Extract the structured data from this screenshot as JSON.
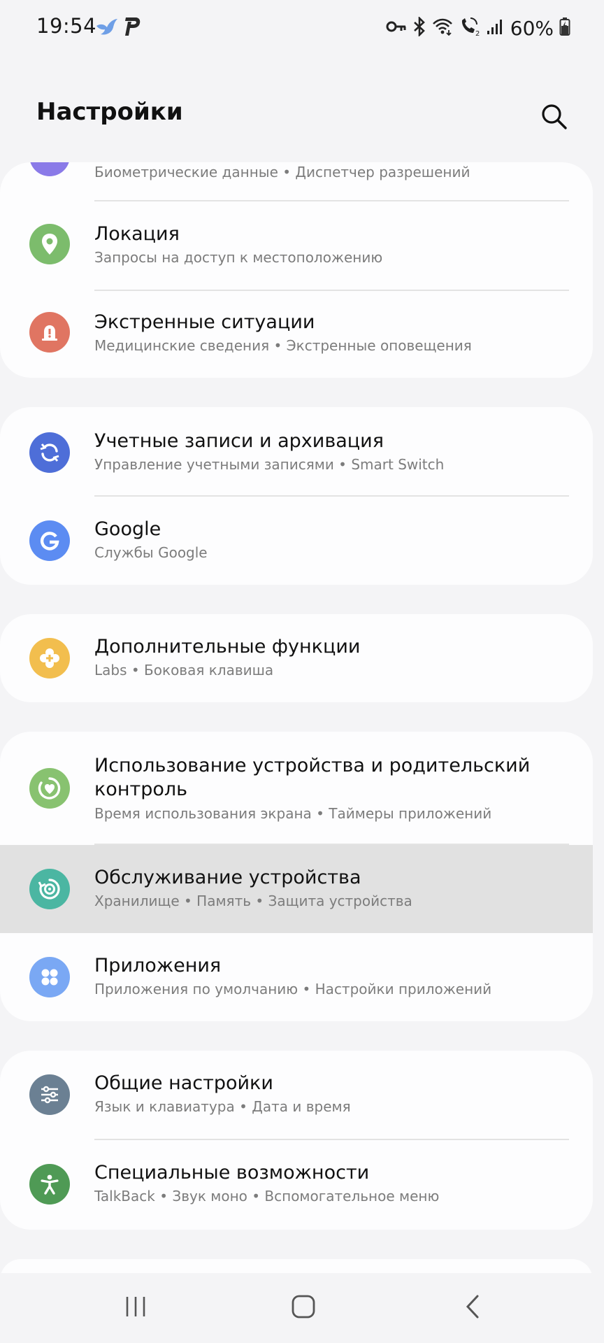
{
  "status": {
    "time": "19:54",
    "battery": "60%"
  },
  "header": {
    "title": "Настройки"
  },
  "icons": {
    "biometric": "fingerprint-shield-icon",
    "location": "location-pin-icon",
    "emergency": "emergency-alert-icon",
    "accounts": "sync-icon",
    "google": "google-g-icon",
    "advanced": "puzzle-plus-icon",
    "wellbeing": "heart-circle-icon",
    "care": "device-care-icon",
    "apps": "apps-grid-icon",
    "general": "sliders-icon",
    "accessibility": "accessibility-person-icon"
  },
  "colors": {
    "biometric": "#8a7ae8",
    "location": "#7cbc6c",
    "emergency": "#e07562",
    "accounts": "#4e6ed8",
    "google": "#5c8cf2",
    "advanced": "#f2be4e",
    "wellbeing": "#88c270",
    "care": "#4bb6a2",
    "apps": "#7aa8f4",
    "general": "#6b8093",
    "accessibility": "#4f9a55",
    "highlight_row": "#e1e1e1"
  },
  "settings": {
    "biometric": {
      "subtitle": "Биометрические данные • Диспетчер разрешений"
    },
    "location": {
      "title": "Локация",
      "subtitle": "Запросы на доступ к местоположению"
    },
    "emergency": {
      "title": "Экстренные ситуации",
      "subtitle": "Медицинские сведения • Экстренные оповещения"
    },
    "accounts": {
      "title": "Учетные записи и архивация",
      "subtitle": "Управление учетными записями • Smart Switch"
    },
    "google": {
      "title": "Google",
      "subtitle": "Службы Google"
    },
    "advanced": {
      "title": "Дополнительные функции",
      "subtitle": "Labs • Боковая клавиша"
    },
    "wellbeing": {
      "title_line1": "Использование устройства и родительский",
      "title_line2": "контроль",
      "subtitle": "Время использования экрана • Таймеры приложений"
    },
    "care": {
      "title": "Обслуживание устройства",
      "subtitle": "Хранилище • Память • Защита устройства"
    },
    "apps": {
      "title": "Приложения",
      "subtitle": "Приложения по умолчанию • Настройки приложений"
    },
    "general": {
      "title": "Общие настройки",
      "subtitle": "Язык и клавиатура • Дата и время"
    },
    "accessibility": {
      "title": "Специальные возможности",
      "subtitle": "TalkBack • Звук моно • Вспомогательное меню"
    }
  }
}
